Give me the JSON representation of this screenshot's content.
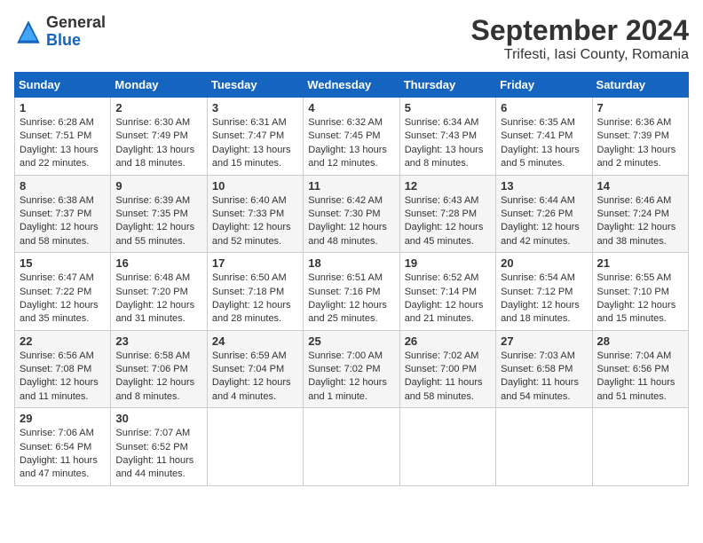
{
  "header": {
    "logo_general": "General",
    "logo_blue": "Blue",
    "title": "September 2024",
    "subtitle": "Trifesti, Iasi County, Romania"
  },
  "calendar": {
    "headers": [
      "Sunday",
      "Monday",
      "Tuesday",
      "Wednesday",
      "Thursday",
      "Friday",
      "Saturday"
    ],
    "weeks": [
      [
        {
          "day": "1",
          "info": "Sunrise: 6:28 AM\nSunset: 7:51 PM\nDaylight: 13 hours\nand 22 minutes."
        },
        {
          "day": "2",
          "info": "Sunrise: 6:30 AM\nSunset: 7:49 PM\nDaylight: 13 hours\nand 18 minutes."
        },
        {
          "day": "3",
          "info": "Sunrise: 6:31 AM\nSunset: 7:47 PM\nDaylight: 13 hours\nand 15 minutes."
        },
        {
          "day": "4",
          "info": "Sunrise: 6:32 AM\nSunset: 7:45 PM\nDaylight: 13 hours\nand 12 minutes."
        },
        {
          "day": "5",
          "info": "Sunrise: 6:34 AM\nSunset: 7:43 PM\nDaylight: 13 hours\nand 8 minutes."
        },
        {
          "day": "6",
          "info": "Sunrise: 6:35 AM\nSunset: 7:41 PM\nDaylight: 13 hours\nand 5 minutes."
        },
        {
          "day": "7",
          "info": "Sunrise: 6:36 AM\nSunset: 7:39 PM\nDaylight: 13 hours\nand 2 minutes."
        }
      ],
      [
        {
          "day": "8",
          "info": "Sunrise: 6:38 AM\nSunset: 7:37 PM\nDaylight: 12 hours\nand 58 minutes."
        },
        {
          "day": "9",
          "info": "Sunrise: 6:39 AM\nSunset: 7:35 PM\nDaylight: 12 hours\nand 55 minutes."
        },
        {
          "day": "10",
          "info": "Sunrise: 6:40 AM\nSunset: 7:33 PM\nDaylight: 12 hours\nand 52 minutes."
        },
        {
          "day": "11",
          "info": "Sunrise: 6:42 AM\nSunset: 7:30 PM\nDaylight: 12 hours\nand 48 minutes."
        },
        {
          "day": "12",
          "info": "Sunrise: 6:43 AM\nSunset: 7:28 PM\nDaylight: 12 hours\nand 45 minutes."
        },
        {
          "day": "13",
          "info": "Sunrise: 6:44 AM\nSunset: 7:26 PM\nDaylight: 12 hours\nand 42 minutes."
        },
        {
          "day": "14",
          "info": "Sunrise: 6:46 AM\nSunset: 7:24 PM\nDaylight: 12 hours\nand 38 minutes."
        }
      ],
      [
        {
          "day": "15",
          "info": "Sunrise: 6:47 AM\nSunset: 7:22 PM\nDaylight: 12 hours\nand 35 minutes."
        },
        {
          "day": "16",
          "info": "Sunrise: 6:48 AM\nSunset: 7:20 PM\nDaylight: 12 hours\nand 31 minutes."
        },
        {
          "day": "17",
          "info": "Sunrise: 6:50 AM\nSunset: 7:18 PM\nDaylight: 12 hours\nand 28 minutes."
        },
        {
          "day": "18",
          "info": "Sunrise: 6:51 AM\nSunset: 7:16 PM\nDaylight: 12 hours\nand 25 minutes."
        },
        {
          "day": "19",
          "info": "Sunrise: 6:52 AM\nSunset: 7:14 PM\nDaylight: 12 hours\nand 21 minutes."
        },
        {
          "day": "20",
          "info": "Sunrise: 6:54 AM\nSunset: 7:12 PM\nDaylight: 12 hours\nand 18 minutes."
        },
        {
          "day": "21",
          "info": "Sunrise: 6:55 AM\nSunset: 7:10 PM\nDaylight: 12 hours\nand 15 minutes."
        }
      ],
      [
        {
          "day": "22",
          "info": "Sunrise: 6:56 AM\nSunset: 7:08 PM\nDaylight: 12 hours\nand 11 minutes."
        },
        {
          "day": "23",
          "info": "Sunrise: 6:58 AM\nSunset: 7:06 PM\nDaylight: 12 hours\nand 8 minutes."
        },
        {
          "day": "24",
          "info": "Sunrise: 6:59 AM\nSunset: 7:04 PM\nDaylight: 12 hours\nand 4 minutes."
        },
        {
          "day": "25",
          "info": "Sunrise: 7:00 AM\nSunset: 7:02 PM\nDaylight: 12 hours\nand 1 minute."
        },
        {
          "day": "26",
          "info": "Sunrise: 7:02 AM\nSunset: 7:00 PM\nDaylight: 11 hours\nand 58 minutes."
        },
        {
          "day": "27",
          "info": "Sunrise: 7:03 AM\nSunset: 6:58 PM\nDaylight: 11 hours\nand 54 minutes."
        },
        {
          "day": "28",
          "info": "Sunrise: 7:04 AM\nSunset: 6:56 PM\nDaylight: 11 hours\nand 51 minutes."
        }
      ],
      [
        {
          "day": "29",
          "info": "Sunrise: 7:06 AM\nSunset: 6:54 PM\nDaylight: 11 hours\nand 47 minutes."
        },
        {
          "day": "30",
          "info": "Sunrise: 7:07 AM\nSunset: 6:52 PM\nDaylight: 11 hours\nand 44 minutes."
        },
        {
          "day": "",
          "info": ""
        },
        {
          "day": "",
          "info": ""
        },
        {
          "day": "",
          "info": ""
        },
        {
          "day": "",
          "info": ""
        },
        {
          "day": "",
          "info": ""
        }
      ]
    ]
  }
}
